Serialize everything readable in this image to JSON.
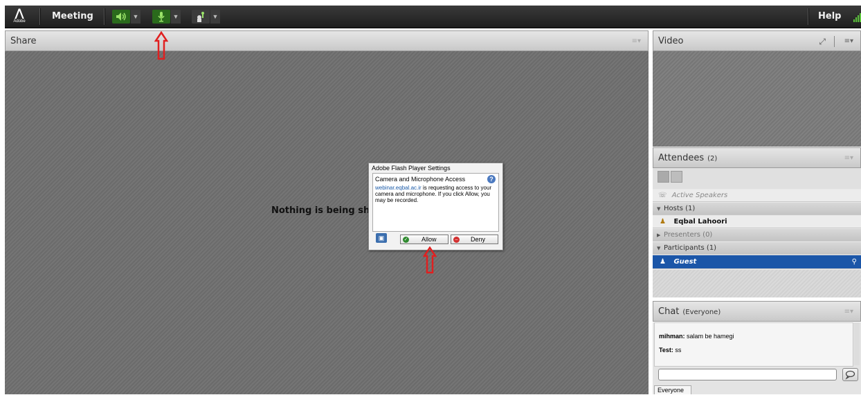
{
  "menubar": {
    "logo_text": "Adobe",
    "meeting_label": "Meeting",
    "help_label": "Help"
  },
  "share_pod": {
    "title": "Share",
    "empty_message": "Nothing is being sha"
  },
  "flash_dialog": {
    "title": "Adobe Flash Player Settings",
    "heading": "Camera and Microphone Access",
    "domain": "webinar.eqbal.ac.ir",
    "body_text": " is requesting access to your camera and microphone. If you click Allow, you may be recorded.",
    "allow_label": "Allow",
    "deny_label": "Deny"
  },
  "video_pod": {
    "title": "Video"
  },
  "attendees_pod": {
    "title": "Attendees",
    "count": "(2)",
    "active_speakers_label": "Active Speakers",
    "hosts_group": "Hosts (1)",
    "host_name": "Eqbal Lahoori",
    "presenters_group": "Presenters (0)",
    "participants_group": "Participants (1)",
    "participant_name": "Guest"
  },
  "chat_pod": {
    "title": "Chat",
    "scope": "(Everyone)",
    "messages": [
      {
        "sender": "mihman:",
        "text": " salam be hamegi"
      },
      {
        "sender": "Test:",
        "text": " ss"
      }
    ],
    "tab_label": "Everyone"
  },
  "colors": {
    "selected_row": "#1b56a8",
    "speaker_active": "#2a6a1c",
    "arrow_red": "#e02020"
  }
}
